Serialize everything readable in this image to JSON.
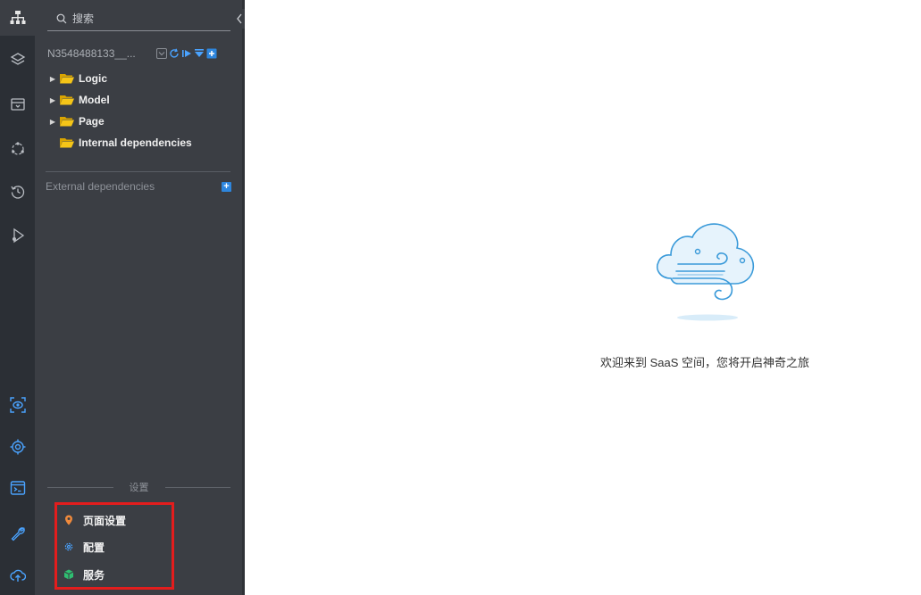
{
  "search": {
    "placeholder": "搜索"
  },
  "project": {
    "name": "N3548488133__..."
  },
  "tree": {
    "items": [
      {
        "label": "Logic",
        "expandable": true
      },
      {
        "label": "Model",
        "expandable": true
      },
      {
        "label": "Page",
        "expandable": true
      },
      {
        "label": "Internal dependencies",
        "expandable": false
      }
    ]
  },
  "external": {
    "label": "External dependencies"
  },
  "settings": {
    "header": "设置",
    "items": [
      {
        "label": "页面设置",
        "icon": "location-pin-icon"
      },
      {
        "label": "配置",
        "icon": "gear-icon"
      },
      {
        "label": "服务",
        "icon": "service-cube-icon"
      }
    ]
  },
  "main": {
    "welcome": "欢迎来到 SaaS 空间，您将开启神奇之旅"
  },
  "colors": {
    "rail_bg": "#2b2f35",
    "panel_bg": "#3b3e44",
    "accent": "#2e86de",
    "highlight": "#e31d1d",
    "folder": "#f5c518"
  }
}
